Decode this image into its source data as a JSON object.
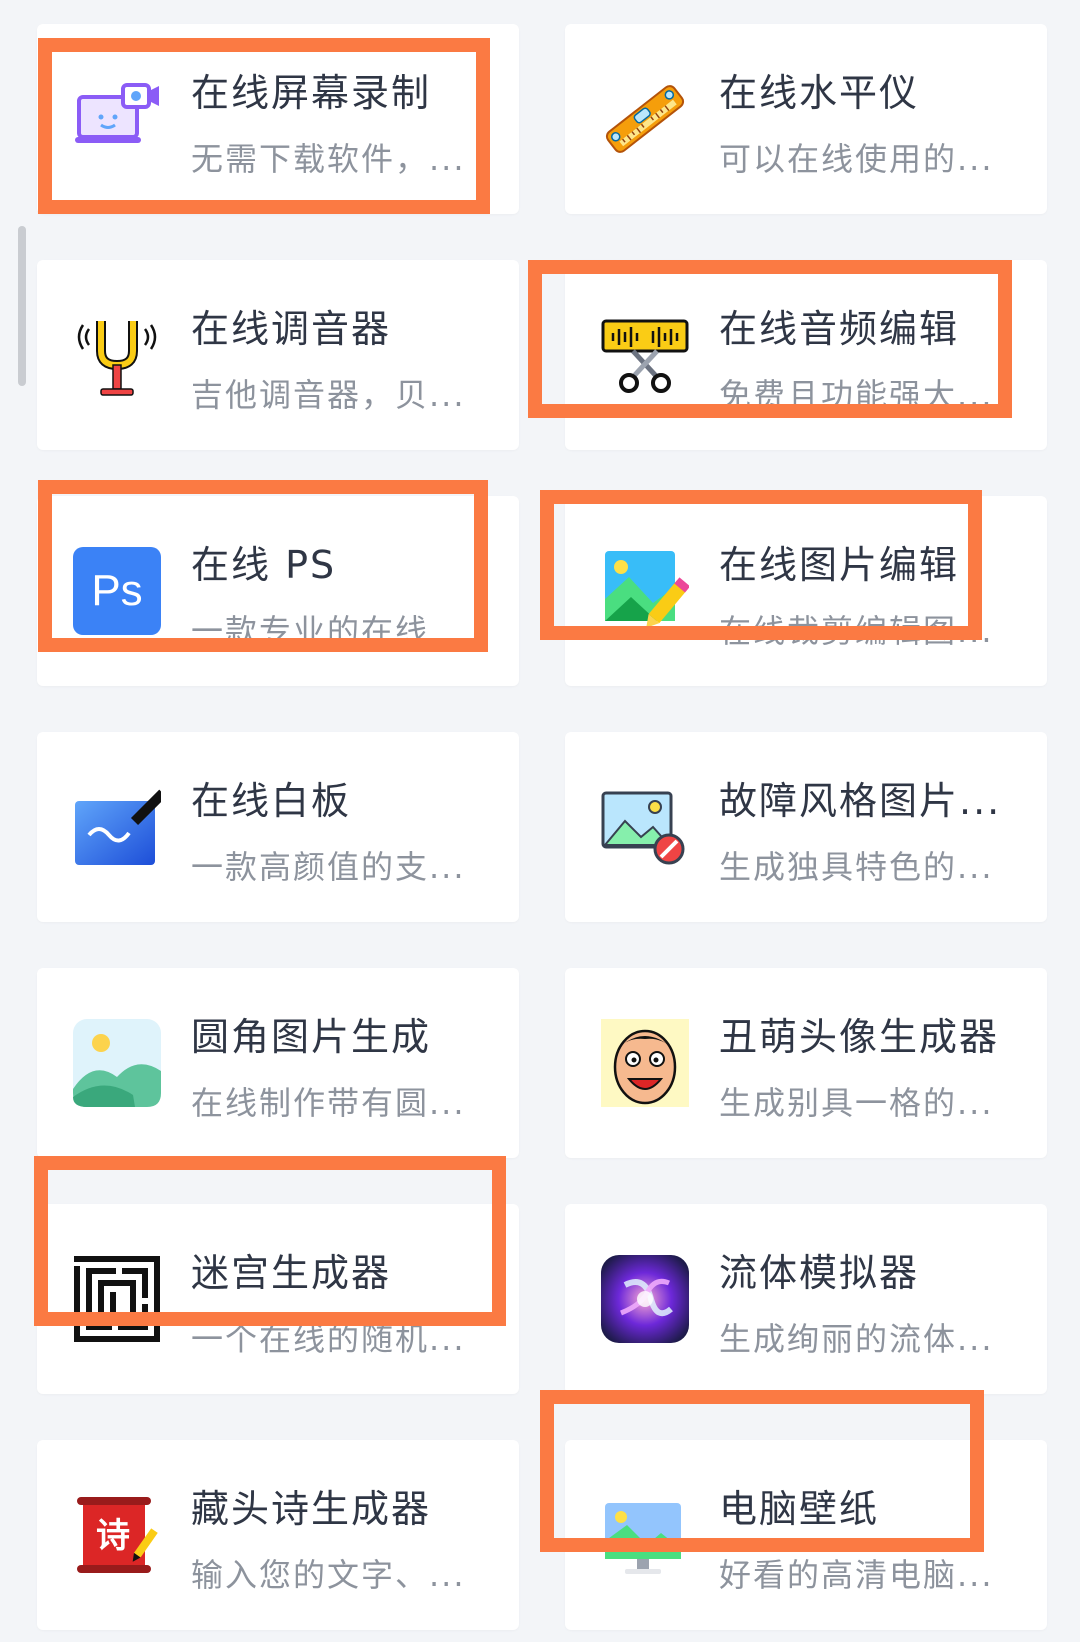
{
  "tools": [
    {
      "title": "在线屏幕录制",
      "desc": "无需下载软件，...",
      "icon": "screen-recorder-icon",
      "highlighted": true
    },
    {
      "title": "在线水平仪",
      "desc": "可以在线使用的...",
      "icon": "spirit-level-icon",
      "highlighted": false
    },
    {
      "title": "在线调音器",
      "desc": "吉他调音器，贝...",
      "icon": "tuning-fork-icon",
      "highlighted": false
    },
    {
      "title": "在线音频编辑",
      "desc": "免费且功能强大...",
      "icon": "audio-cut-icon",
      "highlighted": true
    },
    {
      "title": "在线 PS",
      "desc": "一款专业的在线...",
      "icon": "photoshop-icon",
      "highlighted": true
    },
    {
      "title": "在线图片编辑",
      "desc": "在线裁剪编辑图...",
      "icon": "image-edit-icon",
      "highlighted": true
    },
    {
      "title": "在线白板",
      "desc": "一款高颜值的支...",
      "icon": "whiteboard-icon",
      "highlighted": false
    },
    {
      "title": "故障风格图片...",
      "desc": "生成独具特色的...",
      "icon": "glitch-image-icon",
      "highlighted": false
    },
    {
      "title": "圆角图片生成",
      "desc": "在线制作带有圆...",
      "icon": "rounded-image-icon",
      "highlighted": false
    },
    {
      "title": "丑萌头像生成器",
      "desc": "生成别具一格的...",
      "icon": "ugly-avatar-icon",
      "highlighted": false
    },
    {
      "title": "迷宫生成器",
      "desc": "一个在线的随机...",
      "icon": "maze-icon",
      "highlighted": true
    },
    {
      "title": "流体模拟器",
      "desc": "生成绚丽的流体...",
      "icon": "fluid-icon",
      "highlighted": false
    },
    {
      "title": "藏头诗生成器",
      "desc": "输入您的文字、...",
      "icon": "poem-icon",
      "highlighted": false
    },
    {
      "title": "电脑壁纸",
      "desc": "好看的高清电脑...",
      "icon": "wallpaper-icon",
      "highlighted": true
    }
  ],
  "poem_icon_char": "诗",
  "ps_icon_text": "Ps",
  "colors": {
    "highlight": "#fb7a43",
    "title": "#2f3645",
    "desc": "#8d939d",
    "background": "#f3f5f8"
  }
}
